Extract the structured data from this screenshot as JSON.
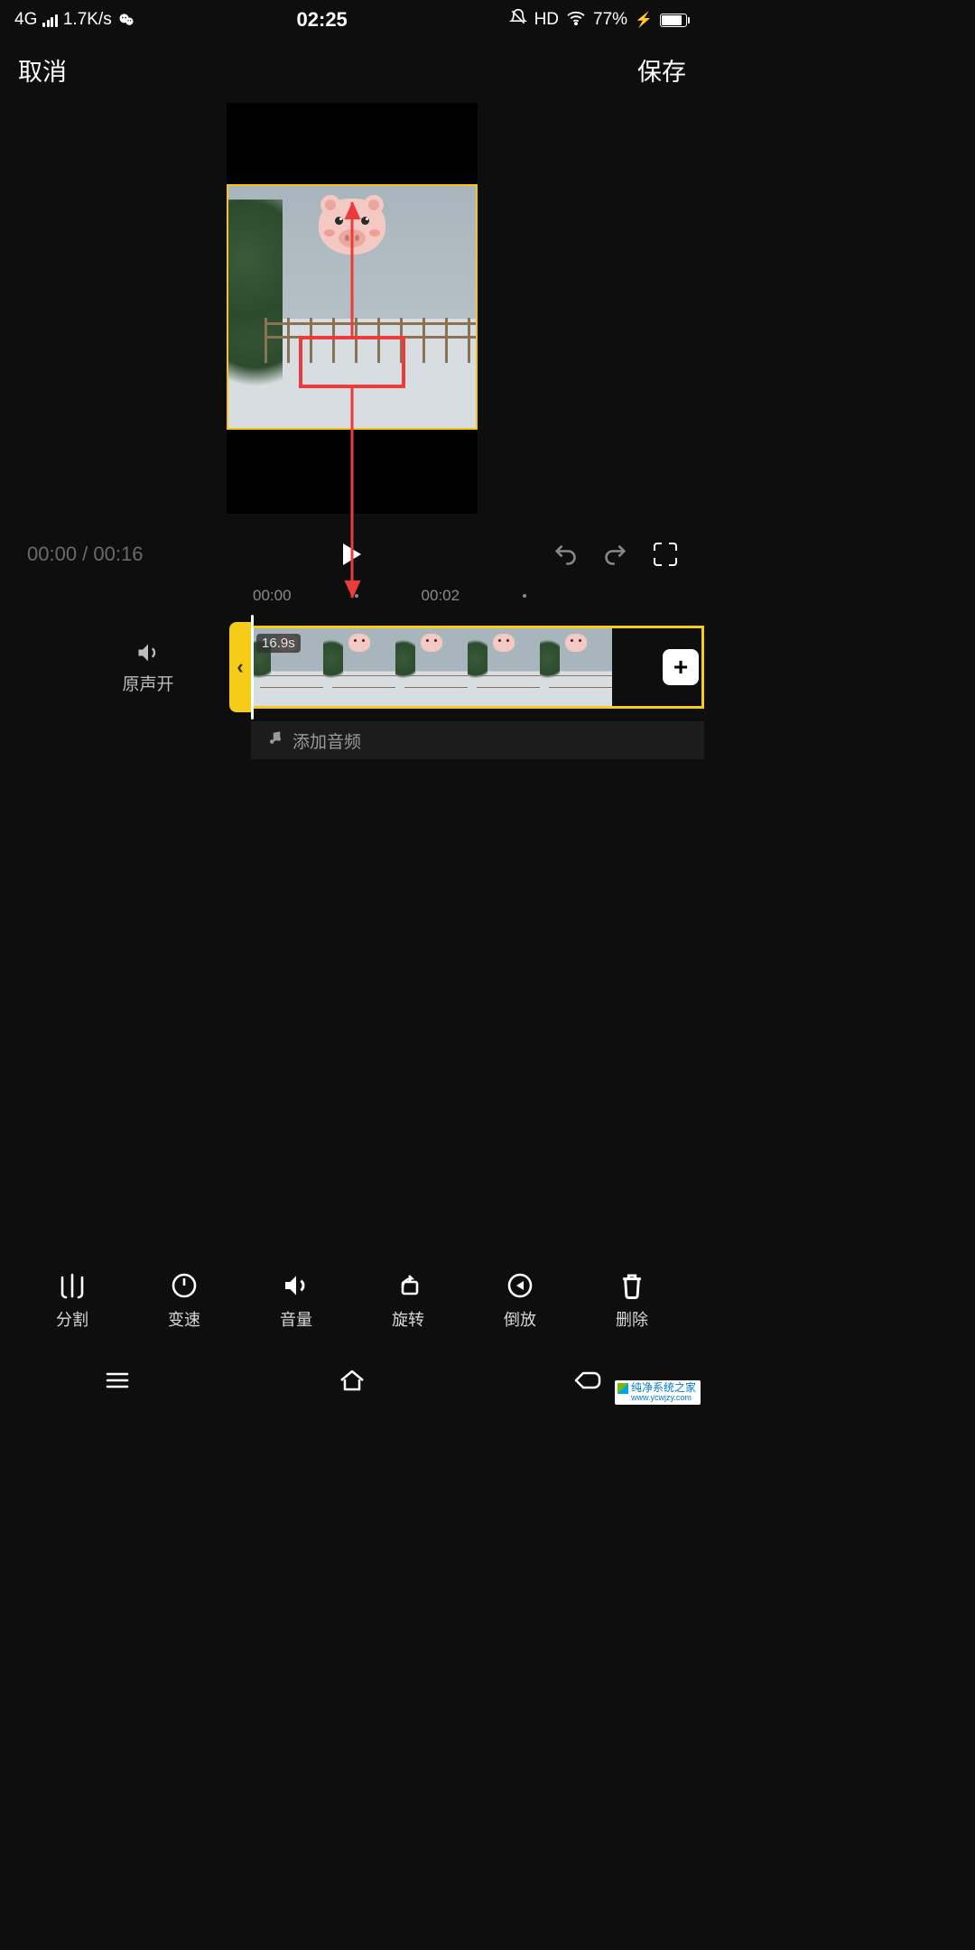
{
  "status": {
    "network": "4G",
    "speed": "1.7K/s",
    "time": "02:25",
    "hd": "HD",
    "battery_pct": "77%"
  },
  "header": {
    "cancel": "取消",
    "save": "保存"
  },
  "playback": {
    "current": "00:00",
    "sep": " / ",
    "total": "00:16"
  },
  "ruler": {
    "t0": "00:00",
    "t1": "00:02"
  },
  "timeline": {
    "sound_label": "原声开",
    "clip_handle": "‹",
    "duration_badge": "16.9s",
    "add_label": "+"
  },
  "audio": {
    "add_label": "添加音频"
  },
  "tools": [
    {
      "id": "split",
      "label": "分割"
    },
    {
      "id": "speed",
      "label": "变速"
    },
    {
      "id": "volume",
      "label": "音量"
    },
    {
      "id": "rotate",
      "label": "旋转"
    },
    {
      "id": "reverse",
      "label": "倒放"
    },
    {
      "id": "delete",
      "label": "删除"
    }
  ],
  "watermark": {
    "title": "纯净系统之家",
    "url": "www.ycwjzy.com"
  }
}
